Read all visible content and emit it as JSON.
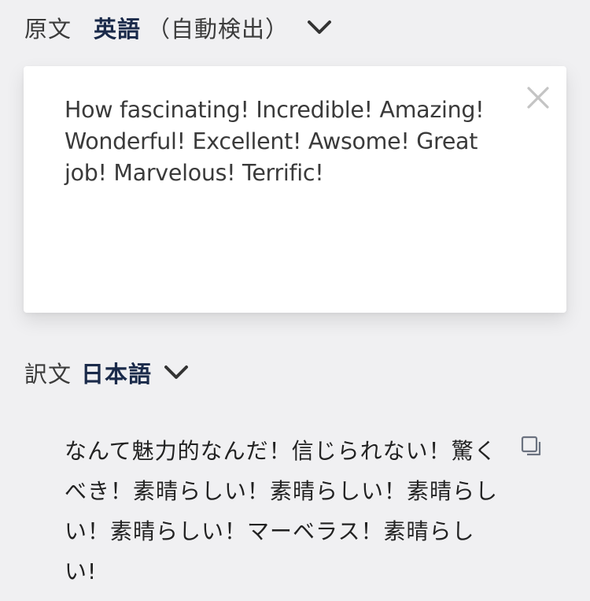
{
  "source_language": {
    "label": "原文",
    "language": "英語",
    "detect_note": "（自動検出）",
    "chevron_icon": "chevron-down-icon"
  },
  "source_card": {
    "text": "How fascinating! Incredible! Amazing! Wonderful! Excellent! Awsome! Great job! Marvelous! Terrific!",
    "clear_icon": "close-icon"
  },
  "target_language": {
    "label": "訳文",
    "language": "日本語",
    "chevron_icon": "chevron-down-icon"
  },
  "translation": {
    "text": "なんて魅力的なんだ！信じられない！驚くべき！素晴らしい！素晴らしい！素晴らしい！素晴らしい！マーベラス！素晴らしい!",
    "copy_icon": "copy-icon"
  },
  "colors": {
    "background": "#f0f0f2",
    "card": "#ffffff",
    "language_name": "#1a2a4a",
    "icon": "#6b7280"
  }
}
